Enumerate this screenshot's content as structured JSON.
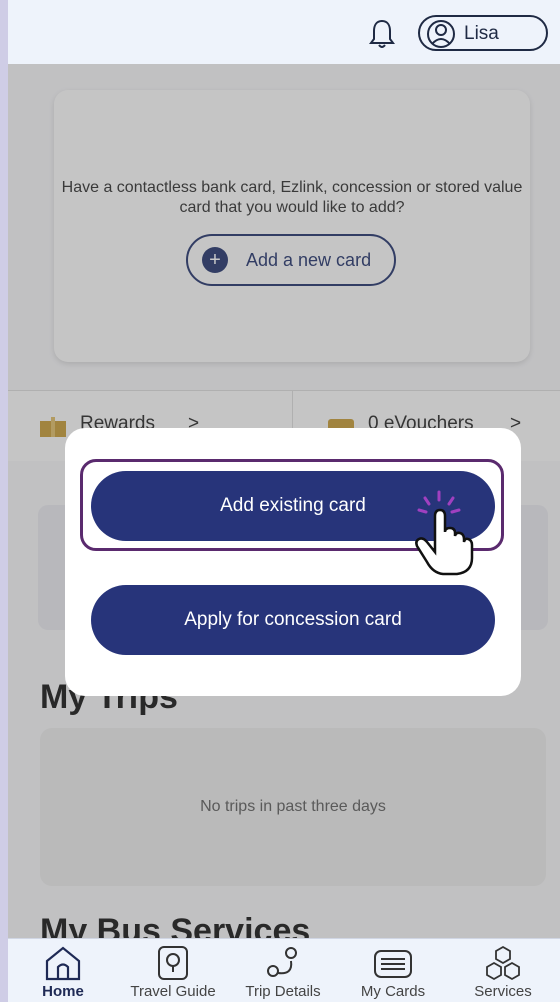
{
  "header": {
    "user_name": "Lisa",
    "icons": [
      "bell-icon",
      "user-icon"
    ]
  },
  "card_prompt": {
    "text": "Have a contactless bank card, Ezlink, concession or stored value card that you would like to add?",
    "button_label": "Add a new card"
  },
  "rewards": {
    "rewards_label": "Rewards",
    "vouchers_label": "0 eVouchers"
  },
  "my_trips": {
    "title": "My Trips",
    "empty_text": "No trips in past three days"
  },
  "bus_services": {
    "title": "My Bus Services"
  },
  "popup": {
    "add_existing_label": "Add existing card",
    "apply_concession_label": "Apply for concession card"
  },
  "nav": {
    "items": [
      {
        "label": "Home",
        "icon": "home-icon",
        "active": true
      },
      {
        "label": "Travel Guide",
        "icon": "map-pin-icon",
        "active": false
      },
      {
        "label": "Trip Details",
        "icon": "route-icon",
        "active": false
      },
      {
        "label": "My Cards",
        "icon": "card-icon",
        "active": false
      },
      {
        "label": "Services",
        "icon": "boxes-icon",
        "active": false
      }
    ]
  },
  "colors": {
    "primary": "#27347a",
    "highlight": "#5a2a6e",
    "background": "#f4f4f6"
  }
}
